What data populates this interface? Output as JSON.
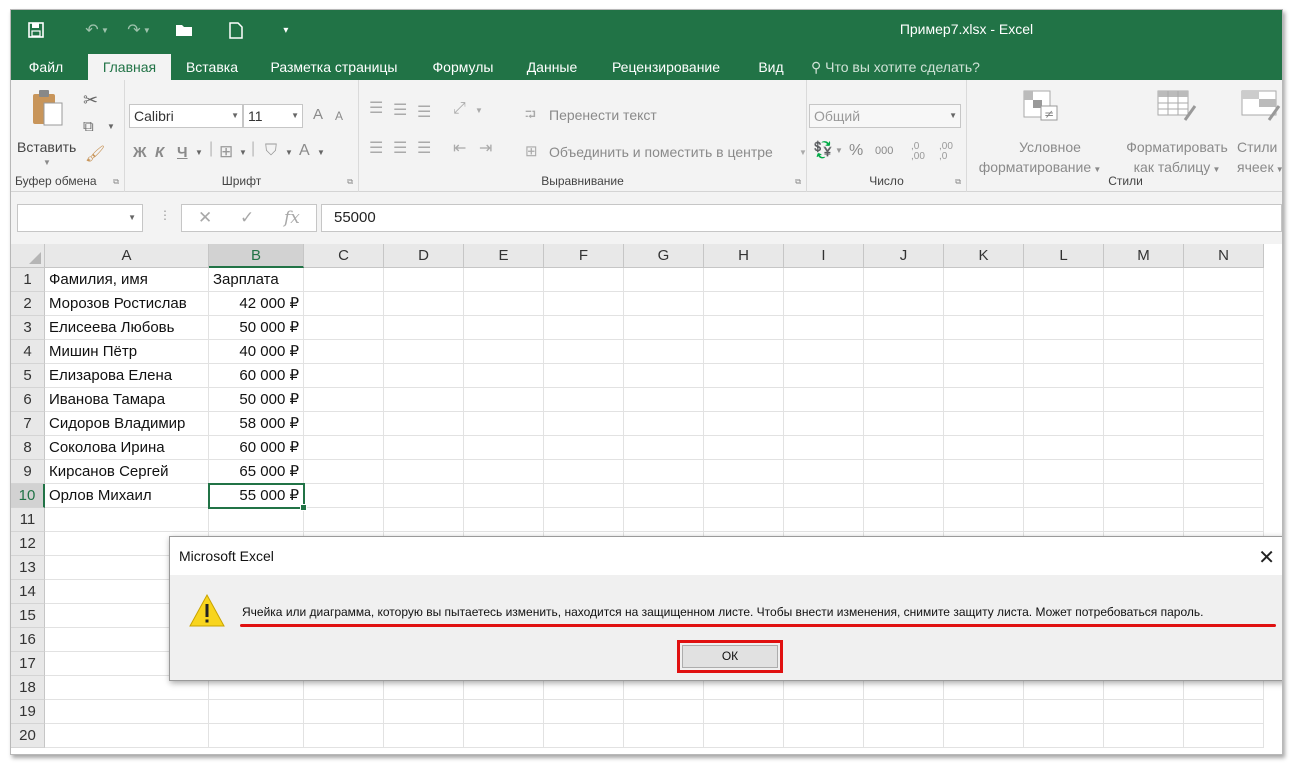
{
  "window": {
    "title": "Пример7.xlsx - Excel"
  },
  "tabs": [
    "Файл",
    "Главная",
    "Вставка",
    "Разметка страницы",
    "Формулы",
    "Данные",
    "Рецензирование",
    "Вид"
  ],
  "tell_me": "Что вы хотите сделать?",
  "ribbon": {
    "clipboard": {
      "paste": "Вставить",
      "label": "Буфер обмена"
    },
    "font": {
      "name": "Calibri",
      "size": "11",
      "bold": "Ж",
      "italic": "К",
      "underline": "Ч",
      "grow": "A",
      "shrink": "A",
      "font_color": "A",
      "label": "Шрифт"
    },
    "alignment": {
      "wrap": "Перенести текст",
      "merge": "Объединить и поместить в центре",
      "label": "Выравнивание"
    },
    "number": {
      "format": "Общий",
      "percent": "%",
      "thousands": "000",
      "inc_decimal_top": ",0",
      "inc_decimal_bottom": ",00",
      "dec_decimal_top": ",00",
      "dec_decimal_bottom": ",0",
      "label": "Число"
    },
    "styles": {
      "conditional_1": "Условное",
      "conditional_2": "форматирование",
      "table_1": "Форматировать",
      "table_2": "как таблицу",
      "cell_1": "Стили",
      "cell_2": "ячеек",
      "label": "Стили"
    }
  },
  "formula_bar": {
    "name_box": "",
    "value": "55000"
  },
  "columns": [
    "A",
    "B",
    "C",
    "D",
    "E",
    "F",
    "G",
    "H",
    "I",
    "J",
    "K",
    "L",
    "M",
    "N"
  ],
  "rows": [
    "1",
    "2",
    "3",
    "4",
    "5",
    "6",
    "7",
    "8",
    "9",
    "10",
    "11",
    "12",
    "13",
    "14",
    "15",
    "16",
    "17",
    "18",
    "19",
    "20"
  ],
  "table": {
    "header": [
      "Фамилия, имя",
      "Зарплата"
    ],
    "data": [
      [
        "Морозов Ростислав",
        "42 000 ₽"
      ],
      [
        "Елисеева Любовь",
        "50 000 ₽"
      ],
      [
        "Мишин Пётр",
        "40 000 ₽"
      ],
      [
        "Елизарова Елена",
        "60 000 ₽"
      ],
      [
        "Иванова Тамара",
        "50 000 ₽"
      ],
      [
        "Сидоров Владимир",
        "58 000 ₽"
      ],
      [
        "Соколова Ирина",
        "60 000 ₽"
      ],
      [
        "Кирсанов Сергей",
        "65 000 ₽"
      ],
      [
        "Орлов Михаил",
        "55 000 ₽"
      ]
    ]
  },
  "selection": {
    "column": "B",
    "row": "10"
  },
  "dialog": {
    "title": "Microsoft Excel",
    "message": "Ячейка или диаграмма, которую вы пытаетесь изменить, находится на защищенном листе. Чтобы внести изменения, снимите защиту листа. Может потребоваться пароль.",
    "ok": "ОК"
  },
  "colors": {
    "accent": "#217346",
    "highlight": "#e01010"
  }
}
